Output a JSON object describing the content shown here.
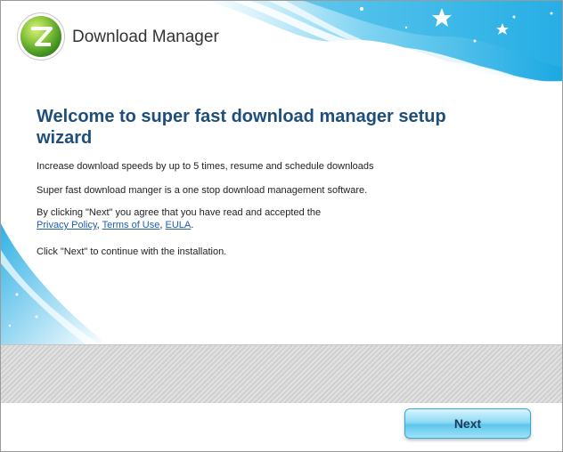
{
  "header": {
    "title": "Download Manager"
  },
  "main": {
    "heading": "Welcome to super fast download manager setup wizard",
    "line1": "Increase download speeds by up to 5 times, resume and schedule downloads",
    "line2": "Super fast download manger is a one stop download management software.",
    "line3": "By clicking \"Next\" you agree that you have read and accepted the",
    "links": {
      "privacy": "Privacy Policy",
      "terms": "Terms of Use",
      "eula": "EULA"
    },
    "sep1": ", ",
    "sep2": ", ",
    "end": ".",
    "line4": "Click \"Next\" to continue with the installation."
  },
  "footer": {
    "next_label": "Next"
  },
  "colors": {
    "accent": "#1e4e79",
    "wave": "#34b6e8",
    "link": "#1f5fa8"
  }
}
